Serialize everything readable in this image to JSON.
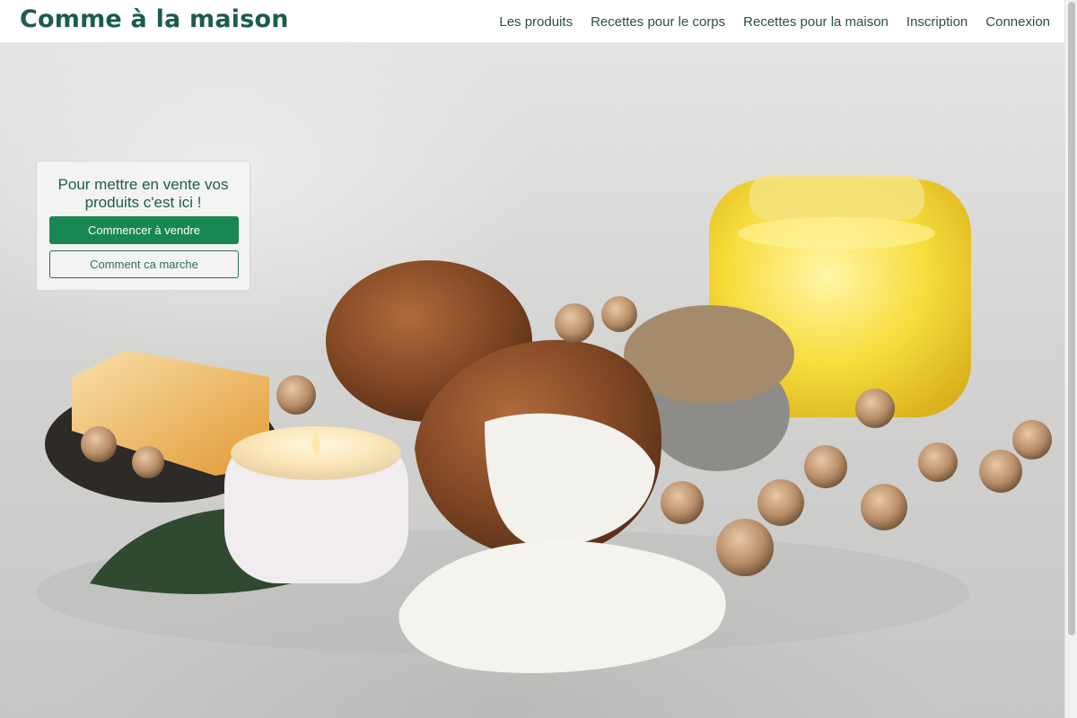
{
  "header": {
    "brand": "Comme à la maison",
    "nav": [
      "Les produits",
      "Recettes pour le corps",
      "Recettes pour la maison",
      "Inscription",
      "Connexion"
    ]
  },
  "hero": {
    "card_title": "Pour mettre en vente vos produits c'est ici !",
    "primary_button": "Commencer à vendre",
    "secondary_button": "Comment ca marche",
    "image_alt": "Still life of coconuts, coconut sugar, a candle, honeycomb soap, dried rose buds and a jar of yellow balm"
  },
  "colors": {
    "brand": "#1d5c45",
    "primary": "#198754",
    "outline": "#2f6e57"
  }
}
